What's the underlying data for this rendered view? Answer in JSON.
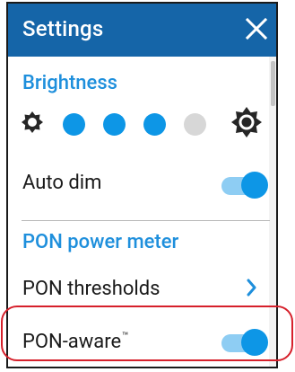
{
  "header": {
    "title": "Settings",
    "close_icon": "close-icon"
  },
  "brightness": {
    "label": "Brightness",
    "level_active": 3,
    "level_max": 4,
    "active_color": "#0d96e6",
    "inactive_color": "#d7d7d7",
    "min_icon": "brightness-low-icon",
    "max_icon": "brightness-high-icon"
  },
  "auto_dim": {
    "label": "Auto dim",
    "enabled": true
  },
  "pon_section": {
    "label": "PON power meter"
  },
  "pon_thresholds": {
    "label": "PON thresholds",
    "icon": "chevron-right-icon"
  },
  "pon_aware": {
    "label": "PON-aware",
    "trademark": "™",
    "enabled": true
  },
  "colors": {
    "header_bg": "#1565a8",
    "accent": "#1e8fdc",
    "toggle_on": "#0d96e6",
    "highlight": "#d6202b"
  }
}
